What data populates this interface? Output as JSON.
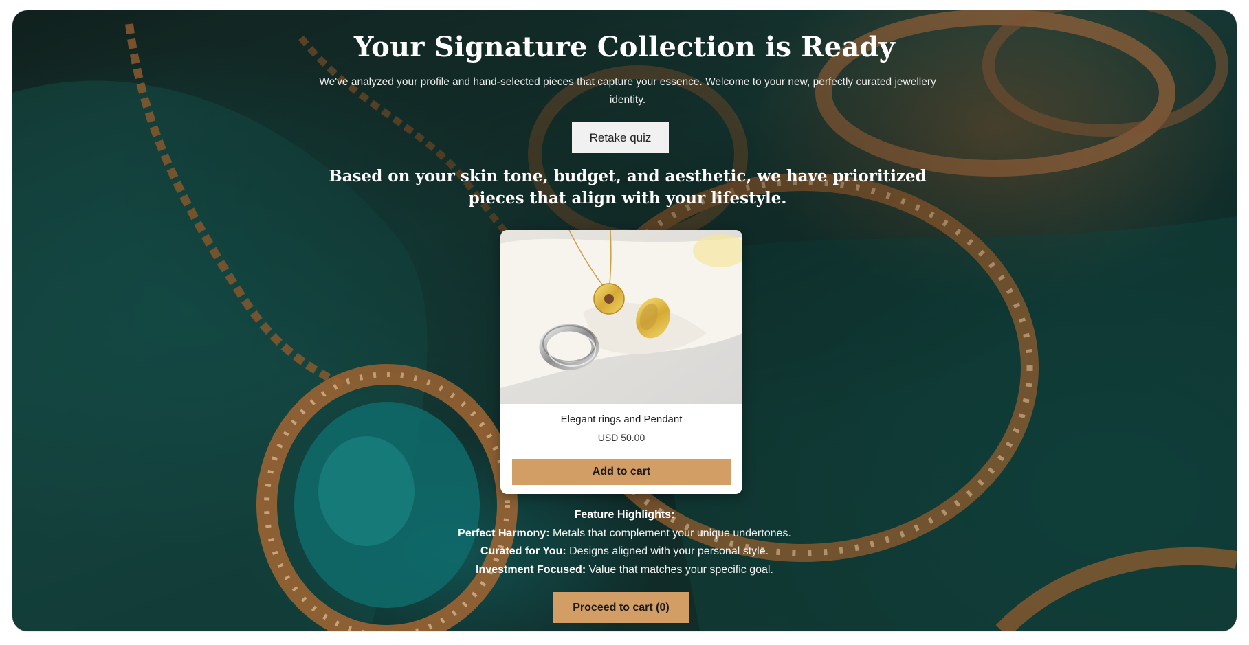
{
  "hero": {
    "title": "Your Signature Collection is Ready",
    "subtitle": "We've analyzed your profile and hand-selected pieces that capture your essence. Welcome to your new, perfectly curated jewellery identity.",
    "retake_label": "Retake quiz",
    "lead_text": "Based on your skin tone, budget, and aesthetic, we have prioritized pieces that align with your lifestyle."
  },
  "product": {
    "name": "Elegant rings and Pendant",
    "price": "USD 50.00",
    "add_label": "Add to cart"
  },
  "features": {
    "heading": "Feature Highlights:",
    "items": [
      {
        "label": "Perfect Harmony:",
        "text": "Metals that complement your unique undertones."
      },
      {
        "label": "Curated for You:",
        "text": "Designs aligned with your personal style."
      },
      {
        "label": "Investment Focused:",
        "text": "Value that matches your specific goal."
      }
    ]
  },
  "cart": {
    "proceed_label": "Proceed to cart (0)"
  },
  "colors": {
    "accent": "#d39d66",
    "background": "#173a35",
    "card": "#ffffff"
  }
}
